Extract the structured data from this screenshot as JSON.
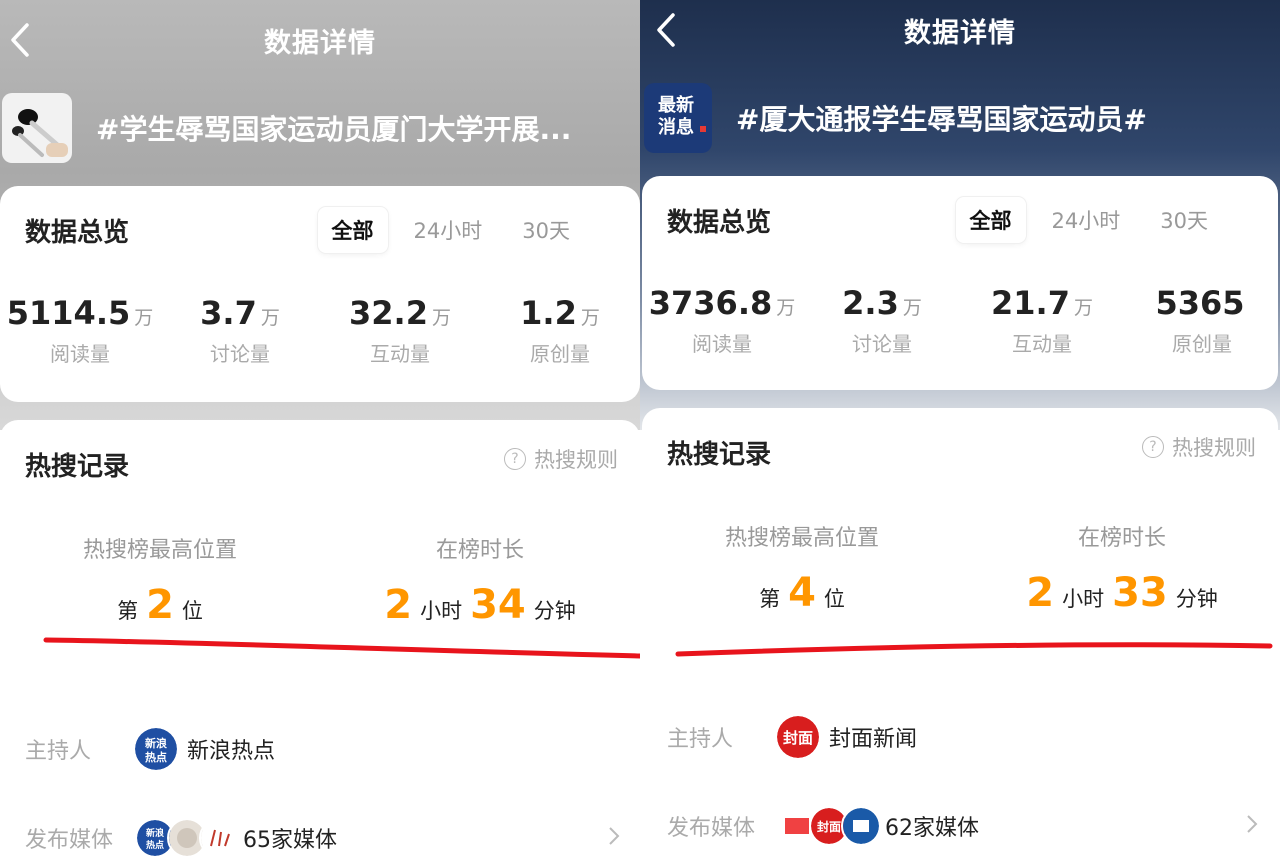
{
  "panels": [
    {
      "nav_title": "数据详情",
      "topic_title": "#学生辱骂国家运动员厦门大学开展...",
      "overview": {
        "title": "数据总览",
        "tabs": [
          {
            "label": "全部",
            "active": true
          },
          {
            "label": "24小时",
            "active": false
          },
          {
            "label": "30天",
            "active": false
          }
        ],
        "stats": [
          {
            "num": "5114.5",
            "unit": "万",
            "label": "阅读量"
          },
          {
            "num": "3.7",
            "unit": "万",
            "label": "讨论量"
          },
          {
            "num": "32.2",
            "unit": "万",
            "label": "互动量"
          },
          {
            "num": "1.2",
            "unit": "万",
            "label": "原创量"
          }
        ]
      },
      "hot": {
        "title": "热搜记录",
        "rules_label": "热搜规则",
        "highest_label": "热搜榜最高位置",
        "rank_prefix": "第",
        "rank": "2",
        "rank_suffix": "位",
        "duration_label": "在榜时长",
        "hours": "2",
        "hours_unit": "小时",
        "minutes": "34",
        "minutes_unit": "分钟"
      },
      "host_label": "主持人",
      "host_name": "新浪热点",
      "host_logo_text": [
        "新浪",
        "热点"
      ],
      "media_label": "发布媒体",
      "media_count": "65家媒体"
    },
    {
      "nav_title": "数据详情",
      "topic_title": "#厦大通报学生辱骂国家运动员#",
      "avatar_text": [
        "最新",
        "消息"
      ],
      "overview": {
        "title": "数据总览",
        "tabs": [
          {
            "label": "全部",
            "active": true
          },
          {
            "label": "24小时",
            "active": false
          },
          {
            "label": "30天",
            "active": false
          }
        ],
        "stats": [
          {
            "num": "3736.8",
            "unit": "万",
            "label": "阅读量"
          },
          {
            "num": "2.3",
            "unit": "万",
            "label": "讨论量"
          },
          {
            "num": "21.7",
            "unit": "万",
            "label": "互动量"
          },
          {
            "num": "5365",
            "unit": "",
            "label": "原创量"
          }
        ]
      },
      "hot": {
        "title": "热搜记录",
        "rules_label": "热搜规则",
        "highest_label": "热搜榜最高位置",
        "rank_prefix": "第",
        "rank": "4",
        "rank_suffix": "位",
        "duration_label": "在榜时长",
        "hours": "2",
        "hours_unit": "小时",
        "minutes": "33",
        "minutes_unit": "分钟"
      },
      "host_label": "主持人",
      "host_name": "封面新闻",
      "host_logo_text": "封面",
      "media_label": "发布媒体",
      "media_count": "62家媒体"
    }
  ],
  "colors": {
    "accent_orange": "#ff9600",
    "annotation_red": "#e8141c",
    "sina_blue": "#1f4fa3",
    "cover_red": "#d81e1e"
  },
  "icons": [
    "back-icon",
    "question-icon",
    "chevron-right-icon"
  ]
}
